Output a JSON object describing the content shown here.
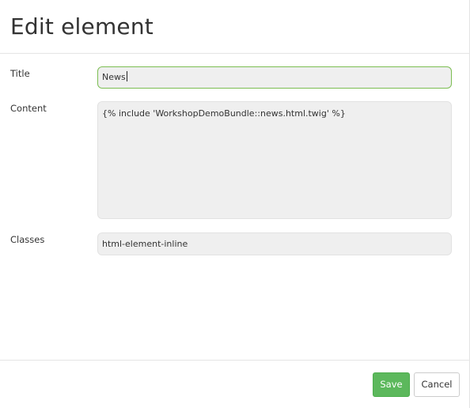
{
  "modal": {
    "title": "Edit element"
  },
  "form": {
    "title": {
      "label": "Title",
      "value": "News"
    },
    "content": {
      "label": "Content",
      "value": "{% include 'WorkshopDemoBundle::news.html.twig' %}"
    },
    "classes": {
      "label": "Classes",
      "value": "html-element-inline"
    }
  },
  "footer": {
    "save_label": "Save",
    "cancel_label": "Cancel"
  },
  "colors": {
    "save_button": "#5cb85c",
    "focused_border": "#7cbd52",
    "field_background": "#efefef"
  }
}
